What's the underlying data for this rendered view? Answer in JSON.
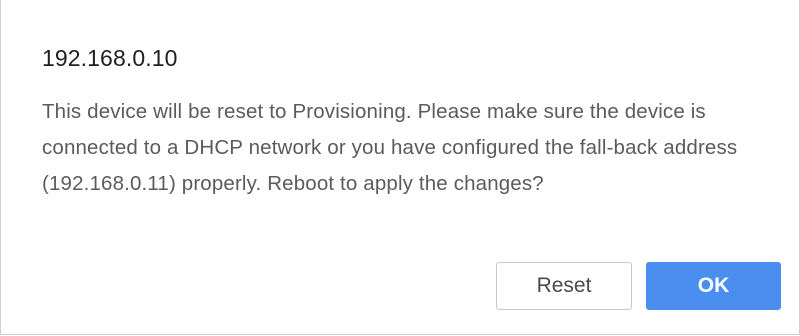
{
  "dialog": {
    "title": "192.168.0.10",
    "message": "This device will be reset to Provisioning. Please make sure the device is connected to a DHCP network or you have configured the fall-back address (192.168.0.11) properly. Reboot to apply the changes?",
    "reset_label": "Reset",
    "ok_label": "OK"
  },
  "colors": {
    "primary": "#4a8ef0",
    "text": "#1f1f1f",
    "message_text": "#5b5b5b"
  }
}
